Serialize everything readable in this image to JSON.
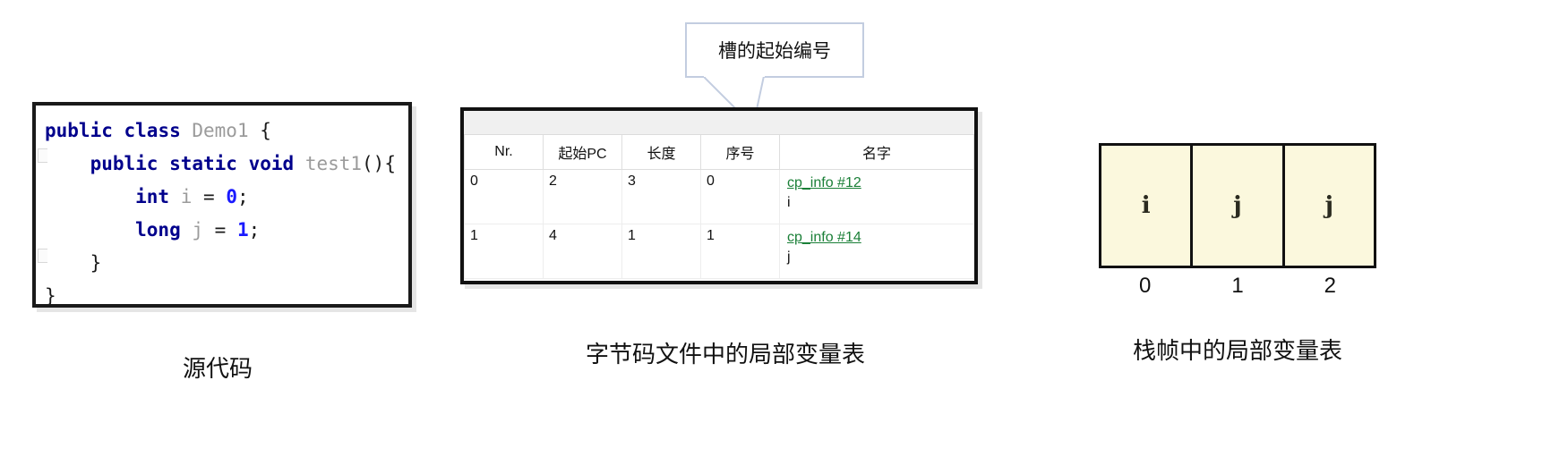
{
  "code_panel": {
    "language": "java",
    "lines": [
      [
        {
          "t": "public ",
          "c": "kw"
        },
        {
          "t": "class ",
          "c": "kw"
        },
        {
          "t": "Demo1 ",
          "c": "pln"
        },
        {
          "t": "{",
          "c": "pnc"
        }
      ],
      [
        {
          "t": "    public ",
          "c": "kw"
        },
        {
          "t": "static ",
          "c": "kw"
        },
        {
          "t": "void ",
          "c": "kw"
        },
        {
          "t": "test1",
          "c": "pln"
        },
        {
          "t": "(){",
          "c": "pnc"
        }
      ],
      [
        {
          "t": "        int ",
          "c": "kw"
        },
        {
          "t": "i ",
          "c": "pln"
        },
        {
          "t": "= ",
          "c": "pnc"
        },
        {
          "t": "0",
          "c": "num"
        },
        {
          "t": ";",
          "c": "pnc"
        }
      ],
      [
        {
          "t": "        long ",
          "c": "kw"
        },
        {
          "t": "j ",
          "c": "pln"
        },
        {
          "t": "= ",
          "c": "pnc"
        },
        {
          "t": "1",
          "c": "num"
        },
        {
          "t": ";",
          "c": "pnc"
        }
      ],
      [
        {
          "t": "    }",
          "c": "pnc"
        }
      ],
      [
        {
          "t": "}",
          "c": "pnc"
        }
      ]
    ]
  },
  "callout": {
    "text": "槽的起始编号"
  },
  "lvt_table": {
    "columns": [
      "Nr.",
      "起始PC",
      "长度",
      "序号",
      "名字"
    ],
    "rows": [
      {
        "nr": "0",
        "start_pc": "2",
        "length": "3",
        "index": "0",
        "name_link": "cp_info #12",
        "name_value": "i"
      },
      {
        "nr": "1",
        "start_pc": "4",
        "length": "1",
        "index": "1",
        "name_link": "cp_info #14",
        "name_value": "j"
      }
    ]
  },
  "slots": {
    "cells": [
      "i",
      "j",
      "j"
    ],
    "indices": [
      "0",
      "1",
      "2"
    ]
  },
  "captions": {
    "source": "源代码",
    "bytecode": "字节码文件中的局部变量表",
    "frame": "栈帧中的局部变量表"
  },
  "colors": {
    "keyword": "#00008c",
    "number": "#1a1aff",
    "link": "#1a7f37",
    "slot_fill": "#fbf8dd",
    "callout_border": "#c3cde0"
  }
}
